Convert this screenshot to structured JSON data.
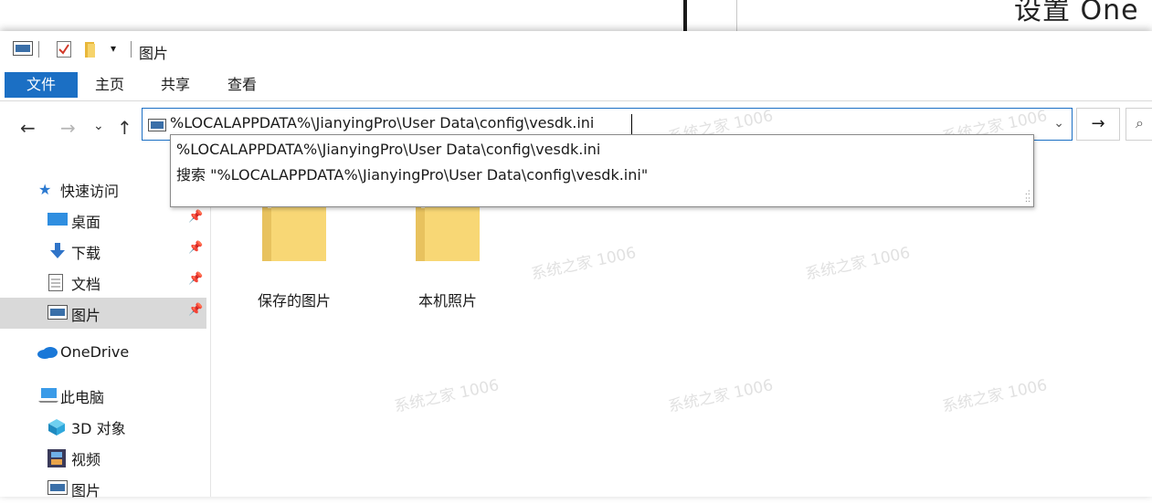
{
  "background_window": {
    "title_fragment": "设置 One"
  },
  "title_bar": {
    "title": "图片",
    "dropdown_glyph": "▾"
  },
  "ribbon": {
    "tabs": [
      "文件",
      "主页",
      "共享",
      "查看"
    ]
  },
  "address_bar": {
    "value": "%LOCALAPPDATA%\\JianyingPro\\User Data\\config\\vesdk.ini",
    "dropdown_glyph": "⌄",
    "go_glyph": "→"
  },
  "nav_buttons": {
    "back": "←",
    "forward": "→",
    "recent": "⌄",
    "up": "↑"
  },
  "suggestions": [
    "%LOCALAPPDATA%\\JianyingPro\\User Data\\config\\vesdk.ini",
    "搜索 \"%LOCALAPPDATA%\\JianyingPro\\User Data\\config\\vesdk.ini\""
  ],
  "nav_pane": {
    "quick_access": "快速访问",
    "items": [
      {
        "label": "桌面",
        "icon": "desktop-icon",
        "pinned": true
      },
      {
        "label": "下载",
        "icon": "download-icon",
        "pinned": true
      },
      {
        "label": "文档",
        "icon": "documents-icon",
        "pinned": true
      },
      {
        "label": "图片",
        "icon": "pictures-icon",
        "pinned": true,
        "selected": true
      }
    ],
    "onedrive": "OneDrive",
    "this_pc": "此电脑",
    "pc_items": [
      {
        "label": "3D 对象",
        "icon": "3d-objects-icon"
      },
      {
        "label": "视频",
        "icon": "videos-icon"
      },
      {
        "label": "图片",
        "icon": "pictures-icon"
      }
    ]
  },
  "folders": [
    {
      "label": "保存的图片"
    },
    {
      "label": "本机照片"
    }
  ],
  "watermark": "系统之家 1006",
  "colors": {
    "accent": "#1b6fc4",
    "selected_bg": "#d9d9d9",
    "folder": "#f8d775"
  }
}
